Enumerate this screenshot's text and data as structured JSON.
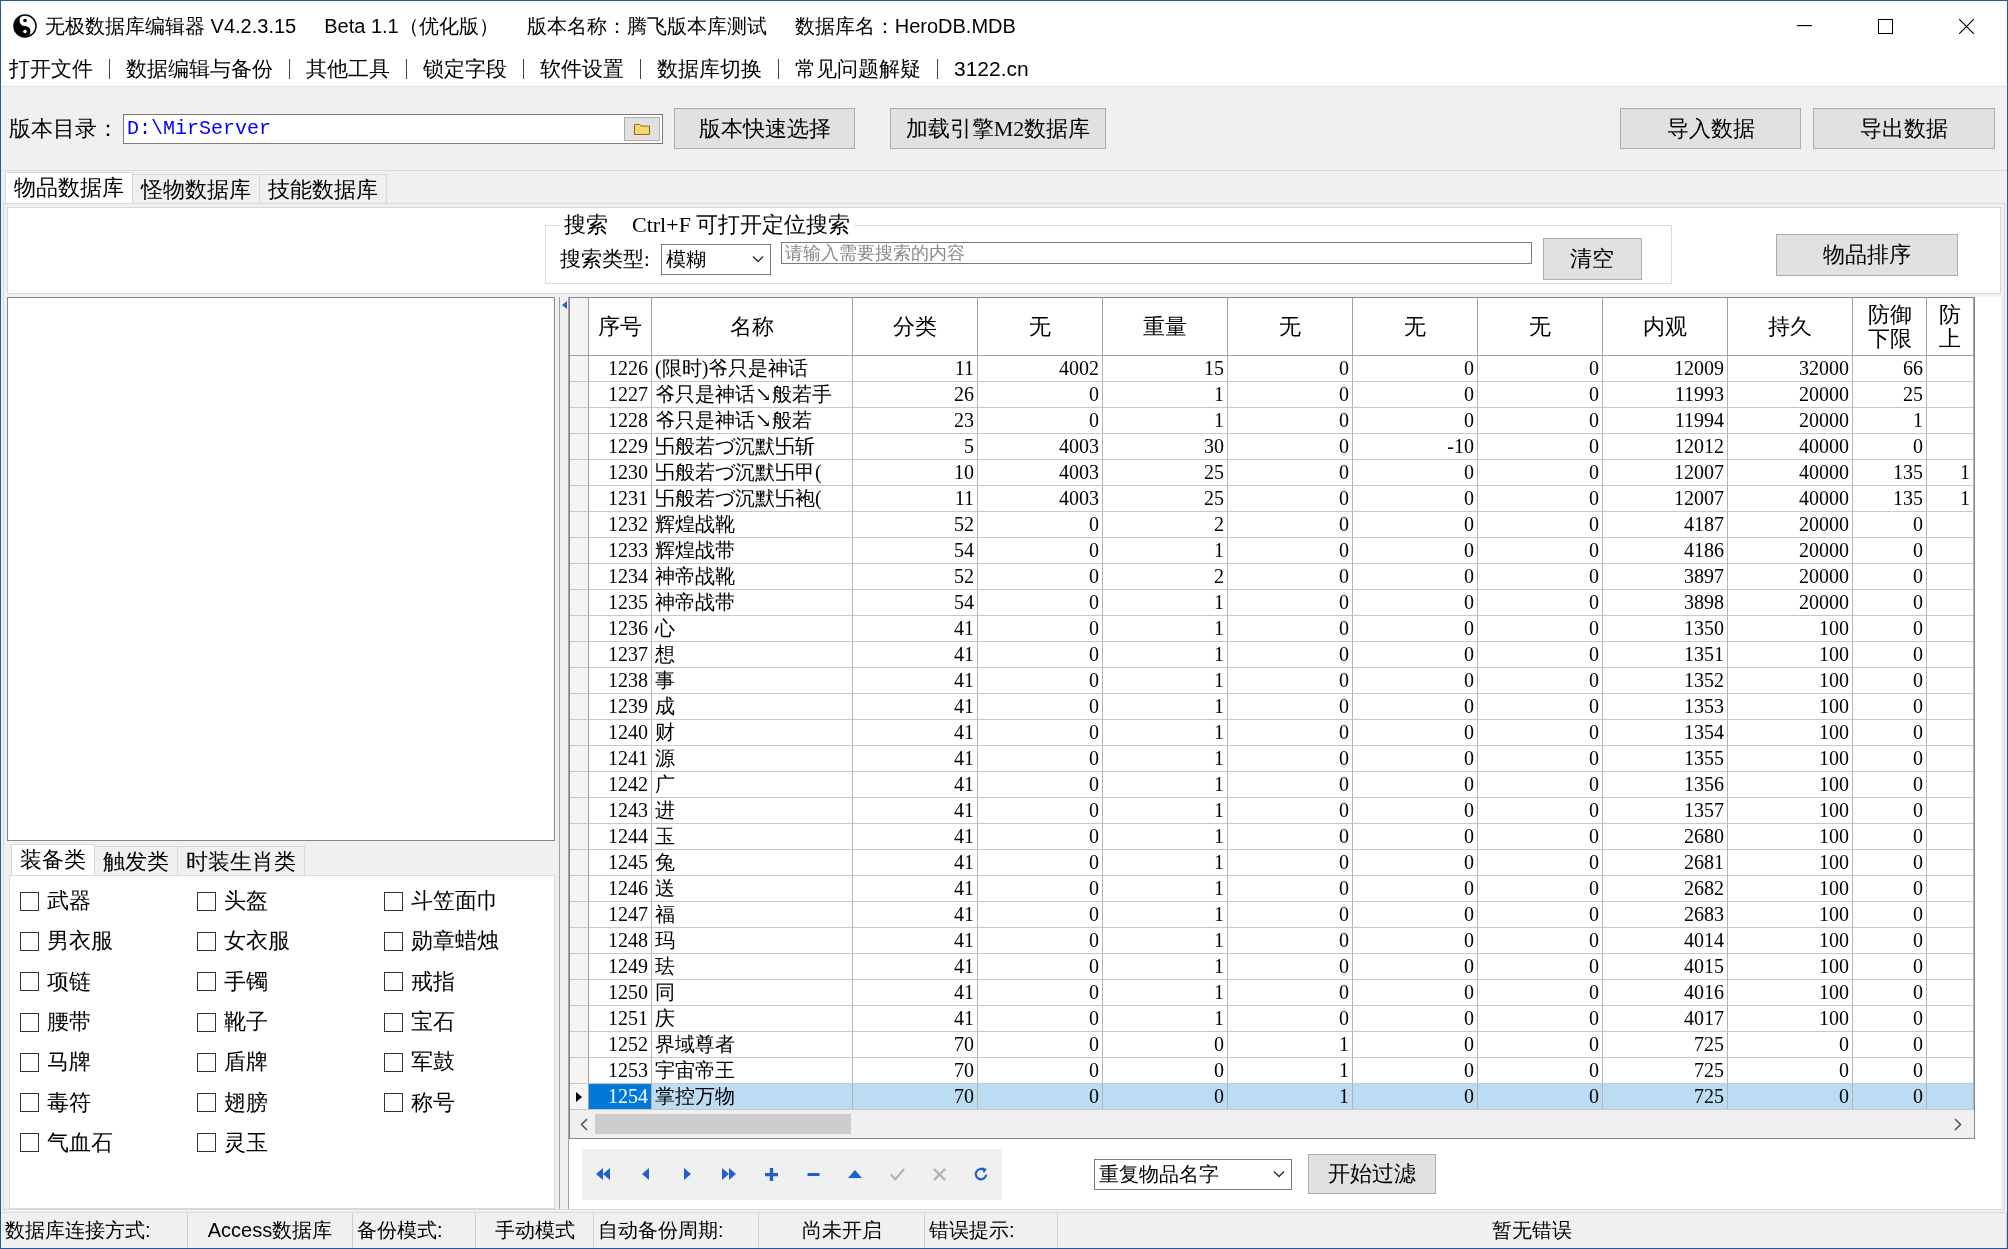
{
  "title_bar": {
    "parts": [
      "无极数据库编辑器 V4.2.3.15",
      "Beta 1.1（优化版）",
      "版本名称：腾飞版本库测试",
      "数据库名：HeroDB.MDB"
    ]
  },
  "menu": [
    "打开文件",
    "数据编辑与备份",
    "其他工具",
    "锁定字段",
    "软件设置",
    "数据库切换",
    "常见问题解疑",
    "3122.cn"
  ],
  "toolbar": {
    "path_label": "版本目录：",
    "path_value": "D:\\MirServer",
    "buttons": [
      "版本快速选择",
      "加载引擎M2数据库"
    ],
    "data_buttons": [
      "导入数据",
      "导出数据"
    ]
  },
  "tabs": [
    {
      "label": "物品数据库",
      "selected": true
    },
    {
      "label": "怪物数据库",
      "selected": false
    },
    {
      "label": "技能数据库",
      "selected": false
    }
  ],
  "search": {
    "title": "搜索",
    "hint": "Ctrl+F 可打开定位搜索",
    "type_label": "搜索类型:",
    "type_value": "模糊",
    "placeholder": "请输入需要搜索的内容",
    "clear_button": "清空"
  },
  "sort_button": "物品排序",
  "category_tabs": [
    {
      "label": "装备类",
      "selected": true
    },
    {
      "label": "触发类",
      "selected": false
    },
    {
      "label": "时装生肖类",
      "selected": false
    }
  ],
  "categories": [
    {
      "label": "武器",
      "checked": false
    },
    {
      "label": "头盔",
      "checked": false
    },
    {
      "label": "斗笠面巾",
      "checked": false
    },
    {
      "label": "男衣服",
      "checked": false
    },
    {
      "label": "女衣服",
      "checked": false
    },
    {
      "label": "勋章蜡烛",
      "checked": false
    },
    {
      "label": "项链",
      "checked": false
    },
    {
      "label": "手镯",
      "checked": false
    },
    {
      "label": "戒指",
      "checked": false
    },
    {
      "label": "腰带",
      "checked": false
    },
    {
      "label": "靴子",
      "checked": false
    },
    {
      "label": "宝石",
      "checked": false
    },
    {
      "label": "马牌",
      "checked": false
    },
    {
      "label": "盾牌",
      "checked": false
    },
    {
      "label": "军鼓",
      "checked": false
    },
    {
      "label": "毒符",
      "checked": false
    },
    {
      "label": "翅膀",
      "checked": false
    },
    {
      "label": "称号",
      "checked": false
    },
    {
      "label": "气血石",
      "checked": false
    },
    {
      "label": "灵玉",
      "checked": false
    }
  ],
  "table": {
    "columns": [
      {
        "lines": [
          "序号"
        ],
        "kind": "number"
      },
      {
        "lines": [
          "名称"
        ],
        "kind": "text"
      },
      {
        "lines": [
          "分类"
        ],
        "kind": "number"
      },
      {
        "lines": [
          "无"
        ],
        "kind": "number"
      },
      {
        "lines": [
          "重量"
        ],
        "kind": "number"
      },
      {
        "lines": [
          "无"
        ],
        "kind": "number"
      },
      {
        "lines": [
          "无"
        ],
        "kind": "number"
      },
      {
        "lines": [
          "无"
        ],
        "kind": "number"
      },
      {
        "lines": [
          "内观"
        ],
        "kind": "number"
      },
      {
        "lines": [
          "持久"
        ],
        "kind": "number"
      },
      {
        "lines": [
          "防御",
          "下限"
        ],
        "kind": "number"
      },
      {
        "lines": [
          "防",
          "上"
        ],
        "kind": "number"
      }
    ],
    "rows": [
      {
        "selected": false,
        "cells": [
          "1226",
          "(限时)爷只是神话",
          "11",
          "4002",
          "15",
          "0",
          "0",
          "0",
          "12009",
          "32000",
          "66"
        ]
      },
      {
        "selected": false,
        "cells": [
          "1227",
          "爷只是神话↘般若手",
          "26",
          "0",
          "1",
          "0",
          "0",
          "0",
          "11993",
          "20000",
          "25"
        ]
      },
      {
        "selected": false,
        "cells": [
          "1228",
          "爷只是神话↘般若",
          "23",
          "0",
          "1",
          "0",
          "0",
          "0",
          "11994",
          "20000",
          "1"
        ]
      },
      {
        "selected": false,
        "cells": [
          "1229",
          "卐般若づ沉默卐斩",
          "5",
          "4003",
          "30",
          "0",
          "-10",
          "0",
          "12012",
          "40000",
          "0"
        ]
      },
      {
        "selected": false,
        "cells": [
          "1230",
          "卐般若づ沉默卐甲(",
          "10",
          "4003",
          "25",
          "0",
          "0",
          "0",
          "12007",
          "40000",
          "135",
          "1"
        ]
      },
      {
        "selected": false,
        "cells": [
          "1231",
          "卐般若づ沉默卐袍(",
          "11",
          "4003",
          "25",
          "0",
          "0",
          "0",
          "12007",
          "40000",
          "135",
          "1"
        ]
      },
      {
        "selected": false,
        "cells": [
          "1232",
          "辉煌战靴",
          "52",
          "0",
          "2",
          "0",
          "0",
          "0",
          "4187",
          "20000",
          "0"
        ]
      },
      {
        "selected": false,
        "cells": [
          "1233",
          "辉煌战带",
          "54",
          "0",
          "1",
          "0",
          "0",
          "0",
          "4186",
          "20000",
          "0"
        ]
      },
      {
        "selected": false,
        "cells": [
          "1234",
          "神帝战靴",
          "52",
          "0",
          "2",
          "0",
          "0",
          "0",
          "3897",
          "20000",
          "0"
        ]
      },
      {
        "selected": false,
        "cells": [
          "1235",
          "神帝战带",
          "54",
          "0",
          "1",
          "0",
          "0",
          "0",
          "3898",
          "20000",
          "0"
        ]
      },
      {
        "selected": false,
        "cells": [
          "1236",
          "心",
          "41",
          "0",
          "1",
          "0",
          "0",
          "0",
          "1350",
          "100",
          "0"
        ]
      },
      {
        "selected": false,
        "cells": [
          "1237",
          "想",
          "41",
          "0",
          "1",
          "0",
          "0",
          "0",
          "1351",
          "100",
          "0"
        ]
      },
      {
        "selected": false,
        "cells": [
          "1238",
          "事",
          "41",
          "0",
          "1",
          "0",
          "0",
          "0",
          "1352",
          "100",
          "0"
        ]
      },
      {
        "selected": false,
        "cells": [
          "1239",
          "成",
          "41",
          "0",
          "1",
          "0",
          "0",
          "0",
          "1353",
          "100",
          "0"
        ]
      },
      {
        "selected": false,
        "cells": [
          "1240",
          "财",
          "41",
          "0",
          "1",
          "0",
          "0",
          "0",
          "1354",
          "100",
          "0"
        ]
      },
      {
        "selected": false,
        "cells": [
          "1241",
          "源",
          "41",
          "0",
          "1",
          "0",
          "0",
          "0",
          "1355",
          "100",
          "0"
        ]
      },
      {
        "selected": false,
        "cells": [
          "1242",
          "广",
          "41",
          "0",
          "1",
          "0",
          "0",
          "0",
          "1356",
          "100",
          "0"
        ]
      },
      {
        "selected": false,
        "cells": [
          "1243",
          "进",
          "41",
          "0",
          "1",
          "0",
          "0",
          "0",
          "1357",
          "100",
          "0"
        ]
      },
      {
        "selected": false,
        "cells": [
          "1244",
          "玉",
          "41",
          "0",
          "1",
          "0",
          "0",
          "0",
          "2680",
          "100",
          "0"
        ]
      },
      {
        "selected": false,
        "cells": [
          "1245",
          "兔",
          "41",
          "0",
          "1",
          "0",
          "0",
          "0",
          "2681",
          "100",
          "0"
        ]
      },
      {
        "selected": false,
        "cells": [
          "1246",
          "送",
          "41",
          "0",
          "1",
          "0",
          "0",
          "0",
          "2682",
          "100",
          "0"
        ]
      },
      {
        "selected": false,
        "cells": [
          "1247",
          "福",
          "41",
          "0",
          "1",
          "0",
          "0",
          "0",
          "2683",
          "100",
          "0"
        ]
      },
      {
        "selected": false,
        "cells": [
          "1248",
          "玛",
          "41",
          "0",
          "1",
          "0",
          "0",
          "0",
          "4014",
          "100",
          "0"
        ]
      },
      {
        "selected": false,
        "cells": [
          "1249",
          "珐",
          "41",
          "0",
          "1",
          "0",
          "0",
          "0",
          "4015",
          "100",
          "0"
        ]
      },
      {
        "selected": false,
        "cells": [
          "1250",
          "同",
          "41",
          "0",
          "1",
          "0",
          "0",
          "0",
          "4016",
          "100",
          "0"
        ]
      },
      {
        "selected": false,
        "cells": [
          "1251",
          "庆",
          "41",
          "0",
          "1",
          "0",
          "0",
          "0",
          "4017",
          "100",
          "0"
        ]
      },
      {
        "selected": false,
        "cells": [
          "1252",
          "界域尊者",
          "70",
          "0",
          "0",
          "1",
          "0",
          "0",
          "725",
          "0",
          "0"
        ]
      },
      {
        "selected": false,
        "cells": [
          "1253",
          "宇宙帝王",
          "70",
          "0",
          "0",
          "1",
          "0",
          "0",
          "725",
          "0",
          "0"
        ]
      },
      {
        "selected": true,
        "cells": [
          "1254",
          "掌控万物",
          "70",
          "0",
          "0",
          "1",
          "0",
          "0",
          "725",
          "0",
          "0"
        ]
      }
    ]
  },
  "navigator": [
    {
      "kind": "first",
      "disabled": false
    },
    {
      "kind": "prior",
      "disabled": false
    },
    {
      "kind": "next",
      "disabled": false
    },
    {
      "kind": "last",
      "disabled": false
    },
    {
      "kind": "insert",
      "disabled": false
    },
    {
      "kind": "delete",
      "disabled": false
    },
    {
      "kind": "edit",
      "disabled": false
    },
    {
      "kind": "post",
      "disabled": true
    },
    {
      "kind": "cancel",
      "disabled": true
    },
    {
      "kind": "refresh",
      "disabled": false
    }
  ],
  "filter": {
    "value": "重复物品名字",
    "button": "开始过滤"
  },
  "status_bar": [
    {
      "label": "数据库连接方式:",
      "value": "Access数据库"
    },
    {
      "label": "备份模式:",
      "value": "手动模式"
    },
    {
      "label": "自动备份周期:",
      "value": "尚未开启"
    },
    {
      "label": "错误提示:",
      "value": "暂无错误"
    }
  ]
}
